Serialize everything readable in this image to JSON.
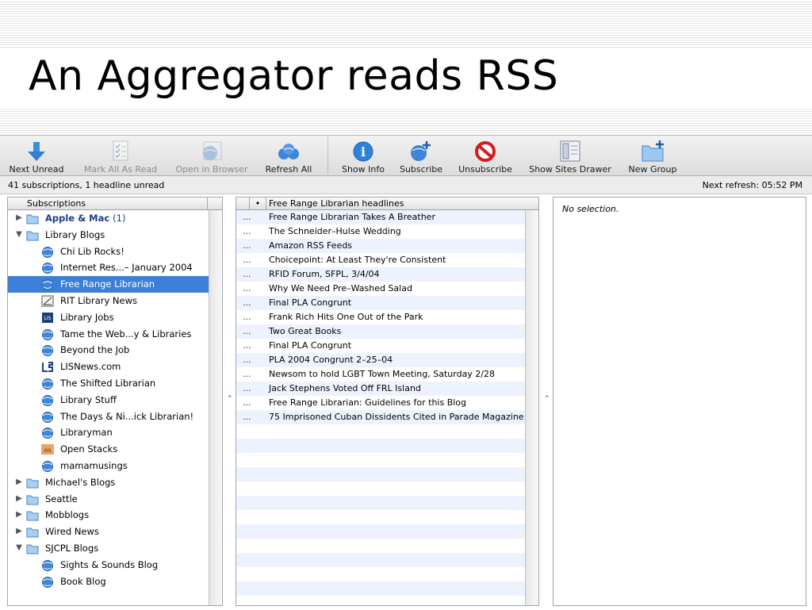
{
  "slide": {
    "title": "An Aggregator reads RSS"
  },
  "toolbar": {
    "next_unread": "Next Unread",
    "mark_all_read": "Mark All As Read",
    "open_browser": "Open in Browser",
    "refresh_all": "Refresh All",
    "show_info": "Show Info",
    "subscribe": "Subscribe",
    "unsubscribe": "Unsubscribe",
    "show_sites_drawer": "Show Sites Drawer",
    "new_group": "New Group"
  },
  "status": {
    "left": "41 subscriptions, 1 headline unread",
    "right": "Next refresh: 05:52 PM"
  },
  "subscriptions": {
    "header": "Subscriptions",
    "items": [
      {
        "label": "Apple & Mac",
        "count": "(1)",
        "type": "folder",
        "expanded": false,
        "bold": true,
        "indent": 0
      },
      {
        "label": "Library Blogs",
        "type": "folder",
        "expanded": true,
        "indent": 0
      },
      {
        "label": "Chi Lib Rocks!",
        "type": "globe",
        "indent": 1
      },
      {
        "label": "Internet Res...– January 2004",
        "type": "globe",
        "indent": 1
      },
      {
        "label": "Free Range Librarian",
        "type": "globe",
        "indent": 1,
        "selected": true
      },
      {
        "label": "RIT Library News",
        "type": "chart",
        "indent": 1
      },
      {
        "label": "Library Jobs",
        "type": "lisjobs",
        "indent": 1
      },
      {
        "label": "Tame the Web...y & Libraries",
        "type": "globe",
        "indent": 1
      },
      {
        "label": "Beyond the Job",
        "type": "globe",
        "indent": 1
      },
      {
        "label": "LISNews.com",
        "type": "lisnews",
        "indent": 1
      },
      {
        "label": "The Shifted Librarian",
        "type": "globe",
        "indent": 1
      },
      {
        "label": "Library Stuff",
        "type": "globe",
        "indent": 1
      },
      {
        "label": "The Days & Ni...ick Librarian!",
        "type": "globe",
        "indent": 1
      },
      {
        "label": "Libraryman",
        "type": "globe",
        "indent": 1
      },
      {
        "label": "Open Stacks",
        "type": "openstacks",
        "indent": 1
      },
      {
        "label": "mamamusings",
        "type": "globe",
        "indent": 1
      },
      {
        "label": "Michael's Blogs",
        "type": "folder",
        "expanded": false,
        "indent": 0
      },
      {
        "label": "Seattle",
        "type": "folder",
        "expanded": false,
        "indent": 0
      },
      {
        "label": "Mobblogs",
        "type": "folder",
        "expanded": false,
        "indent": 0
      },
      {
        "label": "Wired News",
        "type": "folder",
        "expanded": false,
        "indent": 0
      },
      {
        "label": "SJCPL Blogs",
        "type": "folder",
        "expanded": true,
        "indent": 0
      },
      {
        "label": "Sights & Sounds Blog",
        "type": "globe",
        "indent": 1
      },
      {
        "label": "Book Blog",
        "type": "globe",
        "indent": 1
      }
    ]
  },
  "headlines": {
    "header_dot": "•",
    "header": "Free Range Librarian headlines",
    "ellipsis": "...",
    "items": [
      "Free Range Librarian Takes A Breather",
      "The Schneider–Hulse Wedding",
      "Amazon RSS Feeds",
      "Choicepoint: At Least They're Consistent",
      "RFID Forum, SFPL, 3/4/04",
      "Why We Need Pre–Washed Salad",
      "Final PLA Congrunt",
      "Frank Rich Hits One Out of the Park",
      "Two Great Books",
      "Final PLA Congrunt",
      "PLA 2004 Congrunt 2–25–04",
      "Newsom to hold LGBT Town Meeting, Saturday 2/28",
      "Jack Stephens Voted Off FRL Island",
      "Free Range Librarian: Guidelines for this Blog",
      "75 Imprisoned Cuban Dissidents Cited in Parade Magazine"
    ]
  },
  "detail": {
    "no_selection": "No selection."
  },
  "splitter_glyph": "⌃",
  "colors": {
    "selection": "#3d7fd6",
    "alt_row": "#edf3fe",
    "folder_bold": "#1f3c88"
  }
}
